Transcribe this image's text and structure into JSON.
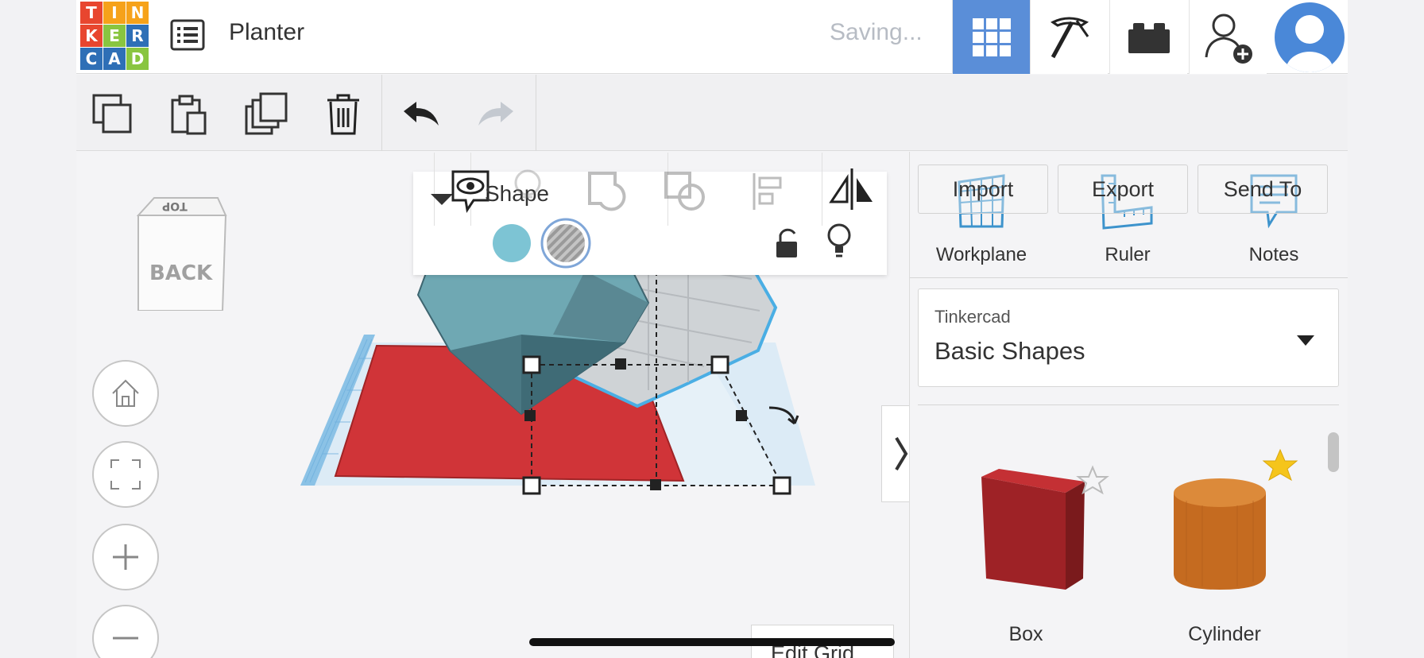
{
  "logo": {
    "letters": [
      "T",
      "I",
      "N",
      "K",
      "E",
      "R",
      "C",
      "A",
      "D"
    ],
    "colors": [
      "#e8462f",
      "#f6a21a",
      "#f6a21a",
      "#e8462f",
      "#89c540",
      "#2e6fb6",
      "#2e6fb6",
      "#2e6fb6",
      "#89c540"
    ]
  },
  "header": {
    "project_name": "Planter",
    "save_status": "Saving...",
    "icons": [
      "list-icon",
      "grid-view-icon",
      "pickaxe-icon",
      "lego-brick-icon",
      "add-user-icon",
      "user-avatar-icon"
    ]
  },
  "toolbar": {
    "icons": [
      "copy-icon",
      "paste-icon",
      "duplicate-icon",
      "delete-icon",
      "undo-icon",
      "redo-icon"
    ]
  },
  "shape_panel": {
    "title": "Shape",
    "colors": {
      "solid": "#7dc4d4",
      "hole": "#b8b8b8"
    },
    "icons": [
      "notes-eye-icon",
      "bulb-icon",
      "group-icon",
      "ungroup-icon",
      "align-icon",
      "mirror-icon",
      "lock-icon",
      "light-icon"
    ]
  },
  "right_panel": {
    "buttons": {
      "import": "Import",
      "export": "Export",
      "send_to": "Send To"
    },
    "tools": {
      "workplane": "Workplane",
      "ruler": "Ruler",
      "notes": "Notes"
    },
    "library": {
      "group": "Tinkercad",
      "value": "Basic Shapes"
    },
    "shapes": [
      {
        "name": "Box",
        "favorite": false
      },
      {
        "name": "Cylinder",
        "favorite": true
      }
    ]
  },
  "view": {
    "cube_face": "BACK",
    "cube_top": "TOP",
    "nav_icons": [
      "home-icon",
      "fit-view-icon",
      "zoom-in-icon",
      "zoom-out-icon"
    ]
  },
  "edit_grid": "Edit Grid",
  "accent_color": "#5a8ed8"
}
